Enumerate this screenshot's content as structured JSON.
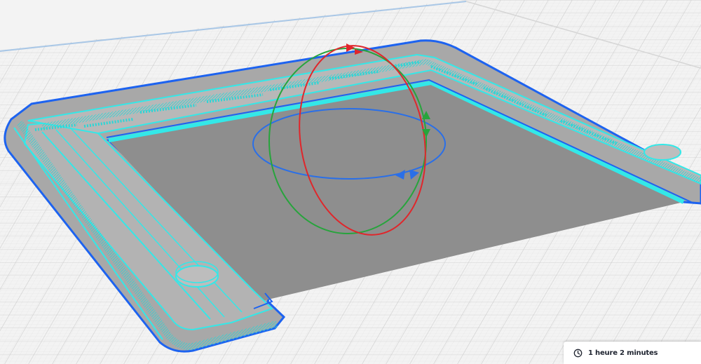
{
  "print_info": {
    "estimated_time": "1 heure 2 minutes",
    "icon": "clock-icon"
  },
  "viewport": {
    "view": "3d-layer-preview",
    "active_tool": "rotate-tool",
    "colors": {
      "background": "#f3f3f3",
      "grid": "#c8c8c8",
      "plate_edge": "#a9c7e6",
      "model_gray": "#9a9a9a",
      "wall_outer": "#1d63f0",
      "wall_inner": "#33e8e8",
      "rotate_x": "#e0262b",
      "rotate_y": "#27a43c",
      "rotate_z": "#2a6fe8"
    }
  }
}
